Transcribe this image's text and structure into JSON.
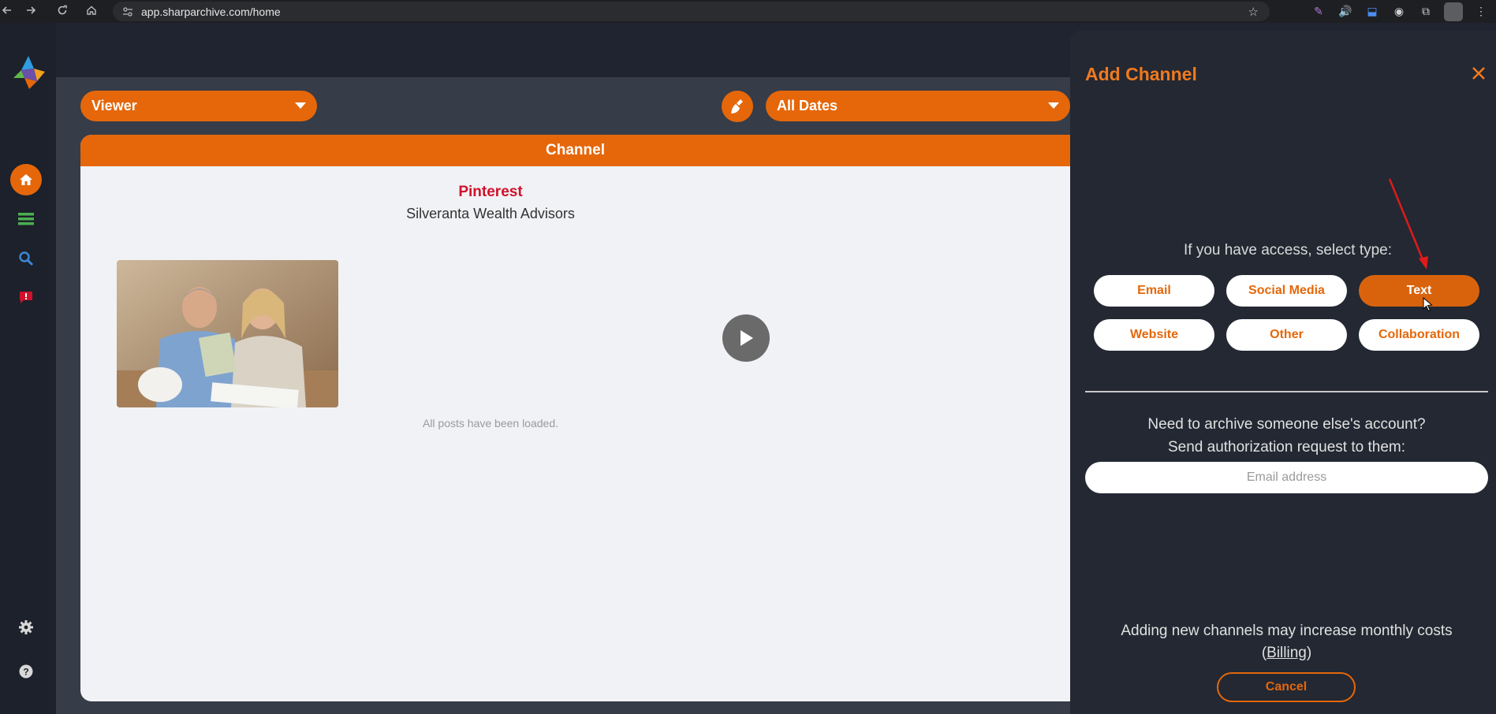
{
  "browser": {
    "url": "app.sharparchive.com/home"
  },
  "sidebar": {
    "items": [
      {
        "name": "home",
        "icon": "home-icon"
      },
      {
        "name": "list",
        "icon": "list-icon"
      },
      {
        "name": "search",
        "icon": "search-icon"
      },
      {
        "name": "alerts",
        "icon": "alert-icon"
      },
      {
        "name": "settings",
        "icon": "gear-icon"
      },
      {
        "name": "help",
        "icon": "help-icon"
      }
    ]
  },
  "filters": {
    "viewer_label": "Viewer",
    "dates_label": "All Dates"
  },
  "channel": {
    "header": "Channel",
    "platform": "Pinterest",
    "account": "Silveranta Wealth Advisors",
    "loaded_message": "All posts have been loaded."
  },
  "add_channel": {
    "title": "Add Channel",
    "select_prompt": "If you have access, select type:",
    "types": [
      "Email",
      "Social Media",
      "Text",
      "Website",
      "Other",
      "Collaboration"
    ],
    "selected_type": "Text",
    "archive_line1": "Need to archive someone else's account?",
    "archive_line2": "Send authorization request to them:",
    "email_placeholder": "Email address",
    "cost_line1": "Adding new channels may increase monthly costs",
    "cost_open": "(",
    "billing_label": "Billing",
    "cost_close": ")",
    "cancel_label": "Cancel"
  },
  "colors": {
    "accent": "#e5670a",
    "panel": "#232833",
    "sidebar": "#1c212b",
    "platform_text": "#d0112b"
  }
}
